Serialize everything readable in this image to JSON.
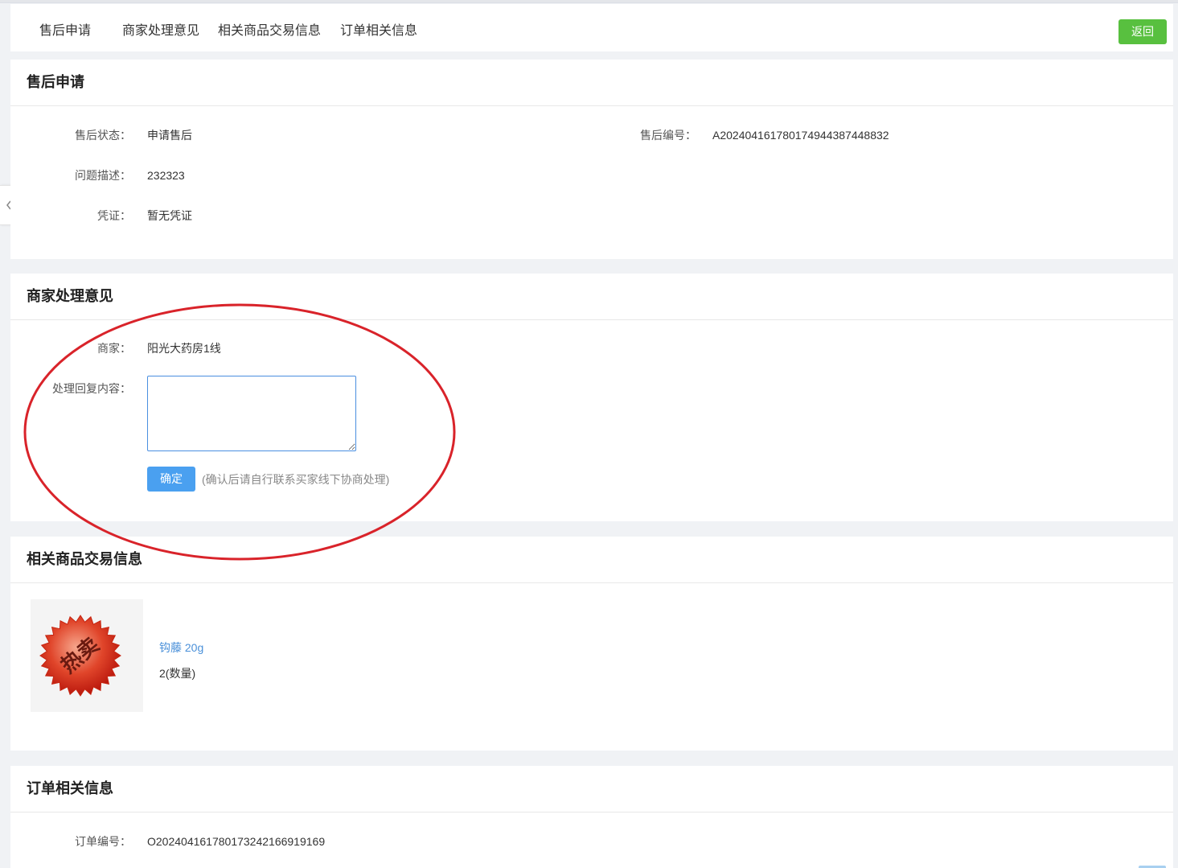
{
  "tabs": [
    "售后申请",
    "商家处理意见",
    "相关商品交易信息",
    "订单相关信息"
  ],
  "back_label": "返回",
  "aftersale": {
    "title": "售后申请",
    "status_label": "售后状态：",
    "status_value": "申请售后",
    "number_label": "售后编号：",
    "number_value": "A20240416178017494438744883 2",
    "desc_label": "问题描述：",
    "desc_value": "232323",
    "proof_label": "凭证：",
    "proof_value": "暂无凭证"
  },
  "merchant": {
    "title": "商家处理意见",
    "merchant_label": "商家：",
    "merchant_value": "阳光大药房1线",
    "reply_label": "处理回复内容：",
    "reply_value": "",
    "confirm_label": "确定",
    "hint": "(确认后请自行联系买家线下协商处理)"
  },
  "goods": {
    "title": "相关商品交易信息",
    "product_name": "钩藤 20g",
    "product_qty": "2(数量)",
    "image_text": "热卖"
  },
  "order": {
    "title": "订单相关信息",
    "number_label": "订单编号：",
    "number_value": "O20240416178017324216691916 9"
  },
  "annotation_color": "#d9232a"
}
